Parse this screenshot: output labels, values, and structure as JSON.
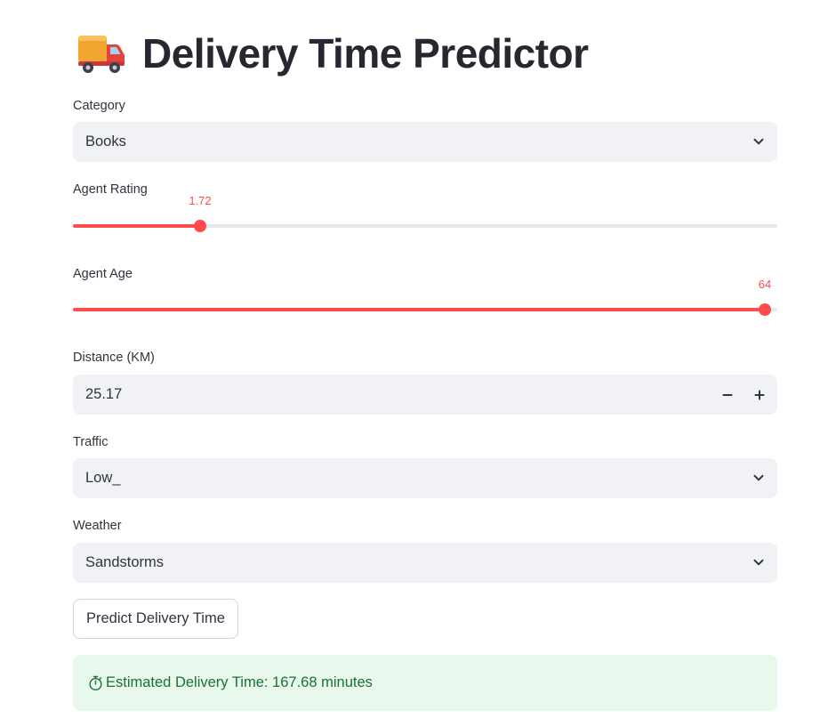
{
  "header": {
    "icon": "delivery-truck-icon",
    "title": "Delivery Time Predictor"
  },
  "category": {
    "label": "Category",
    "selected": "Books",
    "icon": "chevron-down-icon"
  },
  "agent_rating": {
    "label": "Agent Rating",
    "value": "1.72",
    "fraction": 0.18
  },
  "agent_age": {
    "label": "Agent Age",
    "value": "64",
    "fraction": 0.982
  },
  "distance": {
    "label": "Distance (KM)",
    "value": "25.17",
    "decrement_icon": "minus-icon",
    "increment_icon": "plus-icon"
  },
  "traffic": {
    "label": "Traffic",
    "selected": "Low_",
    "icon": "chevron-down-icon"
  },
  "weather": {
    "label": "Weather",
    "selected": "Sandstorms",
    "icon": "chevron-down-icon"
  },
  "predict_button": {
    "label": "Predict Delivery Time"
  },
  "result": {
    "icon": "stopwatch-icon",
    "text": "Estimated Delivery Time: 167.68 minutes"
  },
  "colors": {
    "accent": "#ff4b4b",
    "input_bg": "#f0f2f6",
    "success_bg": "#e9f8ec",
    "success_text": "#177233"
  }
}
